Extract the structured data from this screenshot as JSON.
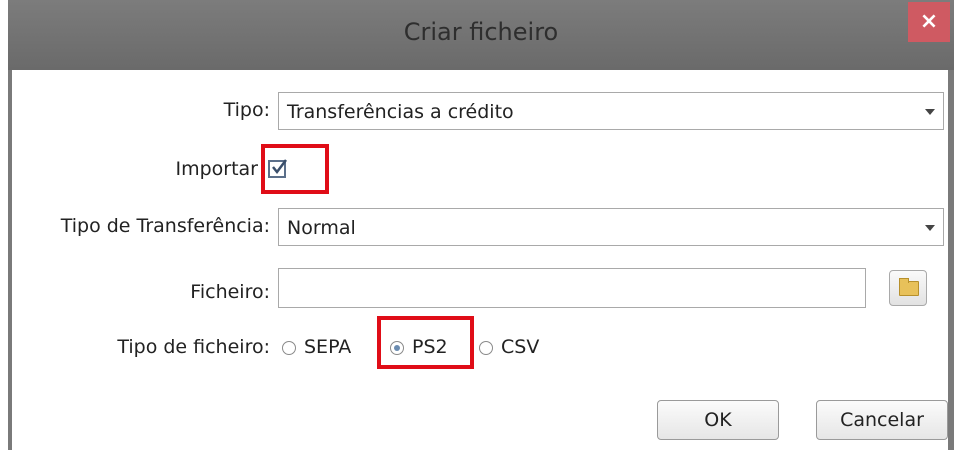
{
  "dialog": {
    "title": "Criar ficheiro",
    "close_label": "×"
  },
  "form": {
    "tipo_label": "Tipo:",
    "tipo_value": "Transferências a crédito",
    "importar_label": "Importar",
    "importar_checked": true,
    "tipo_transferencia_label": "Tipo de Transferência:",
    "tipo_transferencia_value": "Normal",
    "ficheiro_label": "Ficheiro:",
    "ficheiro_value": "",
    "tipo_ficheiro_label": "Tipo de ficheiro:",
    "tipo_ficheiro_options": [
      "SEPA",
      "PS2",
      "CSV"
    ],
    "tipo_ficheiro_selected": "PS2"
  },
  "buttons": {
    "ok_label": "OK",
    "cancel_label": "Cancelar"
  },
  "colors": {
    "highlight": "#e00d17",
    "titlebar": "#6f6f6f",
    "close": "#cf5a62"
  },
  "icons": {
    "close": "close-icon",
    "combo_arrow": "chevron-down-icon",
    "folder": "folder-icon"
  }
}
